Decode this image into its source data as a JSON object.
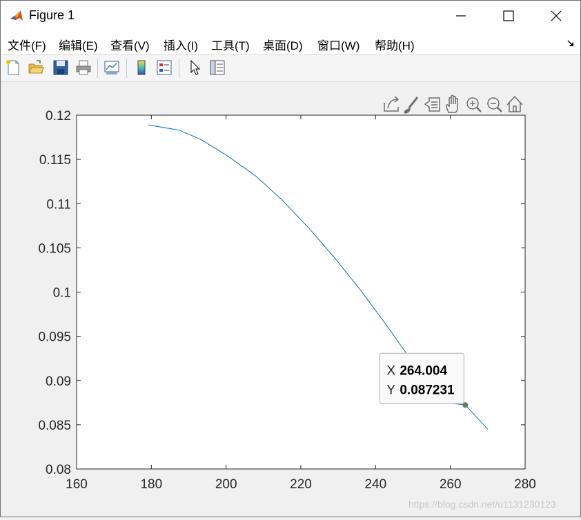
{
  "window": {
    "title": "Figure 1"
  },
  "menu": {
    "items": [
      "文件(F)",
      "编辑(E)",
      "查看(V)",
      "插入(I)",
      "工具(T)",
      "桌面(D)",
      "窗口(W)",
      "帮助(H)"
    ]
  },
  "toolbar": {
    "buttons": [
      "new-figure",
      "open-file",
      "save",
      "print",
      "link-plot",
      "insert-colorbar",
      "insert-legend",
      "edit-plot",
      "property-inspector"
    ]
  },
  "axes_toolbar": {
    "buttons": [
      "export",
      "brush",
      "data-tips",
      "pan",
      "zoom-in",
      "zoom-out",
      "restore-view"
    ]
  },
  "datatip": {
    "x_label": "X",
    "x_value": "264.004",
    "y_label": "Y",
    "y_value": "0.087231"
  },
  "watermark": "https://blog.csdn.net/u1131230123",
  "colors": {
    "line": "#0072bd",
    "marker": "#6f7a5a"
  },
  "chart_data": {
    "type": "line",
    "title": "",
    "xlabel": "",
    "ylabel": "",
    "xlim": [
      160,
      280
    ],
    "ylim": [
      0.08,
      0.12
    ],
    "grid": false,
    "x_ticks": [
      "160",
      "180",
      "200",
      "220",
      "240",
      "260",
      "280"
    ],
    "y_ticks": [
      "0.08",
      "0.085",
      "0.09",
      "0.095",
      "0.1",
      "0.105",
      "0.11",
      "0.115",
      "0.12"
    ],
    "series": [
      {
        "x": [
          179.2,
          187.5,
          193.0,
          200.0,
          208.0,
          215.0,
          222.0,
          229.0,
          236.0,
          243.0,
          250.0,
          257.0,
          264.004,
          270.0
        ],
        "y": [
          0.1189,
          0.1183,
          0.1173,
          0.1155,
          0.1131,
          0.1104,
          0.1073,
          0.1039,
          0.1002,
          0.0962,
          0.092,
          0.0876,
          0.087231,
          0.0845
        ]
      }
    ],
    "datatip_point": {
      "x": 264.004,
      "y": 0.087231
    }
  }
}
